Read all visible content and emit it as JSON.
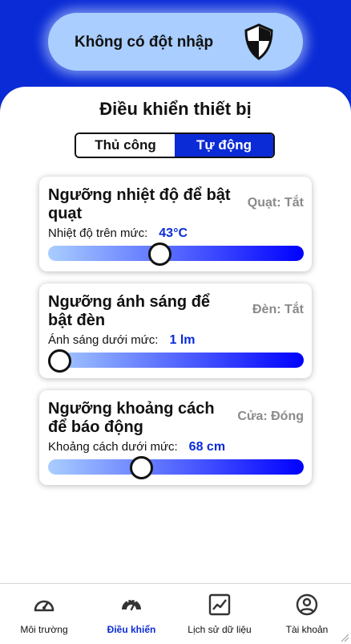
{
  "status_banner": {
    "text": "Không có đột nhập",
    "icon": "shield-icon"
  },
  "page_title": "Điều khiển thiết bị",
  "mode_toggle": {
    "manual": "Thủ công",
    "auto": "Tự động",
    "selected": "auto"
  },
  "cards": [
    {
      "title": "Ngưỡng nhiệt độ để bật quạt",
      "status": "Quạt: Tắt",
      "label": "Nhiệt độ trên mức:",
      "value": "43°C",
      "level": 0.43
    },
    {
      "title": "Ngưỡng ánh sáng để bật đèn",
      "status": "Đèn: Tắt",
      "label": "Ánh sáng dưới mức:",
      "value": "1 lm",
      "level": 0.0
    },
    {
      "title": "Ngưỡng khoảng cách để báo động",
      "status": "Cửa: Đóng",
      "label": "Khoảng cách dưới mức:",
      "value": "68 cm",
      "level": 0.35
    }
  ],
  "nav": [
    {
      "label": "Môi trường",
      "icon": "gauge-icon",
      "active": false
    },
    {
      "label": "Điều khiển",
      "icon": "dashboard-icon",
      "active": true
    },
    {
      "label": "Lịch sử dữ liệu",
      "icon": "chart-icon",
      "active": false
    },
    {
      "label": "Tài khoản",
      "icon": "account-icon",
      "active": false
    }
  ],
  "colors": {
    "primary": "#0a2bd6",
    "banner_pill": "#a9ceff",
    "status_gray": "#8a8a8a"
  }
}
